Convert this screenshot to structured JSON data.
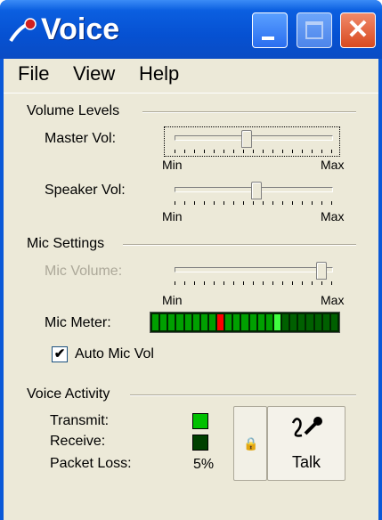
{
  "window": {
    "title": "Voice"
  },
  "menu": [
    "File",
    "View",
    "Help"
  ],
  "volume": {
    "group_title": "Volume Levels",
    "master_label": "Master Vol:",
    "speaker_label": "Speaker Vol:",
    "min": "Min",
    "max": "Max",
    "master_value": 0.45,
    "speaker_value": 0.52
  },
  "mic": {
    "group_title": "Mic Settings",
    "volume_label": "Mic Volume:",
    "min": "Min",
    "max": "Max",
    "volume_value": 0.96,
    "meter_label": "Mic Meter:",
    "meter_segments": [
      "#00a000",
      "#00a000",
      "#00a000",
      "#00a000",
      "#00a000",
      "#00a000",
      "#00a000",
      "#00a000",
      "#ff0000",
      "#00a000",
      "#00a000",
      "#00a000",
      "#00a000",
      "#00a000",
      "#00a000",
      "#40ff40",
      "#006000",
      "#006000",
      "#006000",
      "#006000",
      "#006000",
      "#006000",
      "#006000"
    ],
    "auto_label": "Auto Mic Vol",
    "auto_checked": true
  },
  "activity": {
    "group_title": "Voice Activity",
    "transmit_label": "Transmit:",
    "receive_label": "Receive:",
    "packet_loss_label": "Packet Loss:",
    "packet_loss_value": "5%",
    "transmit_color": "#00c000",
    "receive_color": "#004000",
    "talk_label": "Talk"
  },
  "icons": {
    "app": "microphone-app-icon",
    "lock": "lock-icon",
    "talk": "microphone-icon"
  }
}
